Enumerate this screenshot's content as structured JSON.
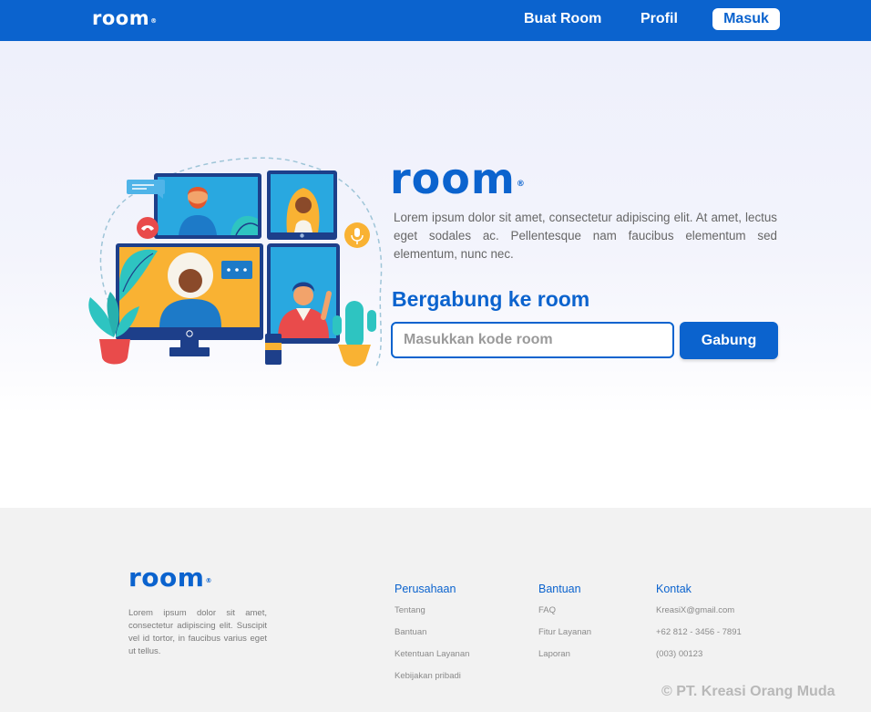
{
  "navbar": {
    "logo": "room",
    "logo_mark": "®",
    "links": {
      "buat_room": "Buat Room",
      "profil": "Profil"
    },
    "login_label": "Masuk"
  },
  "hero": {
    "brand": "room",
    "brand_mark": "®",
    "description": "Lorem ipsum dolor sit amet, consectetur adipiscing elit. At amet, lectus eget sodales ac. Pellentesque nam faucibus elementum sed elementum, nunc nec.",
    "join_title": "Bergabung ke room",
    "code_placeholder": "Masukkan kode room",
    "code_value": "",
    "join_button": "Gabung"
  },
  "footer": {
    "logo": "room",
    "logo_mark": "®",
    "description": "Lorem ipsum dolor sit amet, consectetur adipiscing elit. Suscipit vel id tortor, in faucibus varius eget ut tellus.",
    "columns": {
      "perusahaan": {
        "title": "Perusahaan",
        "items": [
          "Tentang",
          "Bantuan",
          "Ketentuan Layanan",
          "Kebijakan pribadi"
        ]
      },
      "bantuan": {
        "title": "Bantuan",
        "items": [
          "FAQ",
          "Fitur Layanan",
          "Laporan"
        ]
      },
      "kontak": {
        "title": "Kontak",
        "items": [
          "KreasiX@gmail.com",
          "+62 812 - 3456 - 7891",
          "(003) 00123"
        ]
      }
    },
    "copyright": "© PT. Kreasi Orang Muda"
  },
  "colors": {
    "primary": "#0B63CE",
    "hero_bg": "#eef0fb",
    "footer_bg": "#f2f2f2",
    "illustration_yellow": "#F9B233",
    "illustration_teal": "#2EC4C1",
    "illustration_red": "#E94B4B"
  },
  "icons": [
    "registered-mark-icon",
    "phone-hangup-icon",
    "microphone-icon",
    "chat-bubble-icon",
    "copyright-icon"
  ]
}
